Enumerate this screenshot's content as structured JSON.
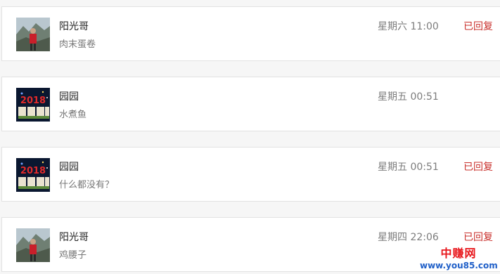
{
  "colors": {
    "reply_status": "#c9302c",
    "watermark_name": "#e8161b",
    "watermark_url": "#1f5fc8"
  },
  "conversations": [
    {
      "avatar": "landscape-portrait-avatar",
      "name": "阳光哥",
      "preview": "肉末蛋卷",
      "time": "星期六 11:00",
      "status": "已回复"
    },
    {
      "avatar": "new-year-2018-avatar",
      "name": "园园",
      "preview": "水煮鱼",
      "time": "星期五 00:51",
      "status": ""
    },
    {
      "avatar": "new-year-2018-avatar",
      "name": "园园",
      "preview": "什么都没有？",
      "time": "星期五 00:51",
      "status": "已回复"
    },
    {
      "avatar": "landscape-portrait-avatar",
      "name": "阳光哥",
      "preview": "鸡腰子",
      "time": "星期四 22:06",
      "status": "已回复"
    }
  ],
  "watermark": {
    "name": "中赚网",
    "url": "www.you85.com"
  }
}
